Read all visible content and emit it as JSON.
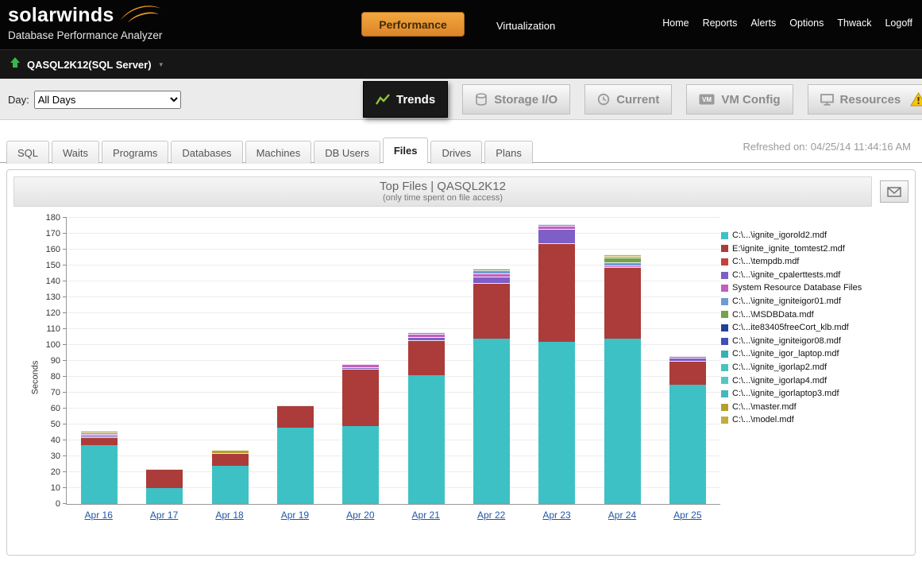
{
  "header": {
    "brand": "solarwinds",
    "subtitle": "Database Performance Analyzer",
    "nav": [
      "Home",
      "Reports",
      "Alerts",
      "Options",
      "Thwack",
      "Logoff"
    ],
    "performance_button": "Performance",
    "virtualization_label": "Virtualization"
  },
  "server_bar": {
    "label": "QASQL2K12(SQL Server)",
    "caret": "▾"
  },
  "toolbar": {
    "day_label": "Day:",
    "day_value": "All Days",
    "view_tabs": [
      {
        "label": "Trends",
        "active": true,
        "icon": "trends-icon"
      },
      {
        "label": "Storage I/O",
        "active": false,
        "icon": "storage-icon"
      },
      {
        "label": "Current",
        "active": false,
        "icon": "clock-icon"
      },
      {
        "label": "VM Config",
        "active": false,
        "icon": "vm-icon"
      },
      {
        "label": "Resources",
        "active": false,
        "icon": "monitor-icon",
        "warning": true
      }
    ]
  },
  "tabstrip": {
    "tabs": [
      {
        "label": "SQL"
      },
      {
        "label": "Waits"
      },
      {
        "label": "Programs"
      },
      {
        "label": "Databases"
      },
      {
        "label": "Machines"
      },
      {
        "label": "DB Users"
      },
      {
        "label": "Files",
        "active": true
      },
      {
        "label": "Drives"
      },
      {
        "label": "Plans"
      }
    ],
    "refreshed": "Refreshed on: 04/25/14 11:44:16 AM"
  },
  "panel": {
    "title": "Top Files | QASQL2K12",
    "subtitle": "(only time spent on file access)"
  },
  "chart_data": {
    "type": "bar",
    "stacked": true,
    "title": "Top Files | QASQL2K12",
    "subtitle": "(only time spent on file access)",
    "ylabel": "Seconds",
    "xlabel": "",
    "ylim": [
      0,
      180
    ],
    "ytick_step": 10,
    "grid": true,
    "legend_position": "right",
    "categories": [
      "Apr 16",
      "Apr 17",
      "Apr 18",
      "Apr 19",
      "Apr 20",
      "Apr 21",
      "Apr 22",
      "Apr 23",
      "Apr 24",
      "Apr 25"
    ],
    "series": [
      {
        "name": "C:\\...\\ignite_igorold2.mdf",
        "color": "#3ec1c5",
        "values": [
          37,
          10,
          24,
          48,
          49,
          81,
          104,
          102,
          104,
          75
        ]
      },
      {
        "name": "E:\\ignite_ignite_tomtest2.mdf",
        "color": "#ab3c39",
        "values": [
          5,
          12,
          8,
          14,
          36,
          22,
          35,
          62,
          45,
          15
        ]
      },
      {
        "name": "C:\\...\\tempdb.mdf",
        "color": "#c4423c",
        "values": [
          0,
          0,
          0,
          0,
          0,
          0,
          0,
          0,
          0,
          0
        ]
      },
      {
        "name": "C:\\...\\ignite_cpalerttests.mdf",
        "color": "#7d5fc7",
        "values": [
          1,
          0,
          0,
          0,
          1,
          2,
          4,
          9,
          0,
          2
        ]
      },
      {
        "name": "System Resource Database Files",
        "color": "#c35ec0",
        "values": [
          1,
          0,
          0,
          0,
          2,
          2,
          2,
          2,
          1,
          1
        ]
      },
      {
        "name": "C:\\...\\ignite_igniteigor01.mdf",
        "color": "#6b9bd2",
        "values": [
          1,
          0,
          0,
          0,
          0,
          1,
          2,
          1,
          2,
          0
        ]
      },
      {
        "name": "C:\\...\\MSDBData.mdf",
        "color": "#76a24a",
        "values": [
          0,
          0,
          0,
          0,
          0,
          0,
          1,
          0,
          3,
          0
        ]
      },
      {
        "name": "C:\\...ite83405freeCort_klb.mdf",
        "color": "#22409a",
        "values": [
          0,
          0,
          0,
          0,
          0,
          0,
          0,
          0,
          0,
          0
        ]
      },
      {
        "name": "C:\\...\\ignite_igniteigor08.mdf",
        "color": "#3f51b5",
        "values": [
          0,
          0,
          0,
          0,
          0,
          0,
          0,
          0,
          0,
          0
        ]
      },
      {
        "name": "C:\\...\\ignite_igor_laptop.mdf",
        "color": "#35b0b5",
        "values": [
          0,
          0,
          0,
          0,
          0,
          0,
          0,
          0,
          0,
          0
        ]
      },
      {
        "name": "C:\\...\\ignite_igorlap2.mdf",
        "color": "#49c4bd",
        "values": [
          0,
          0,
          0,
          0,
          0,
          0,
          0,
          0,
          0,
          0
        ]
      },
      {
        "name": "C:\\...\\ignite_igorlap4.mdf",
        "color": "#52c8c3",
        "values": [
          0,
          0,
          0,
          0,
          0,
          0,
          0,
          0,
          0,
          0
        ]
      },
      {
        "name": "C:\\...\\ignite_igorlaptop3.mdf",
        "color": "#40bac0",
        "values": [
          0,
          0,
          0,
          0,
          0,
          0,
          0,
          0,
          0,
          0
        ]
      },
      {
        "name": "C:\\...\\master.mdf",
        "color": "#b3a02c",
        "values": [
          1,
          0,
          2,
          0,
          0,
          0,
          0,
          0,
          1,
          0
        ]
      },
      {
        "name": "C:\\...\\model.mdf",
        "color": "#c0ad3e",
        "values": [
          0,
          0,
          0,
          0,
          0,
          0,
          0,
          0,
          1,
          0
        ]
      }
    ]
  }
}
